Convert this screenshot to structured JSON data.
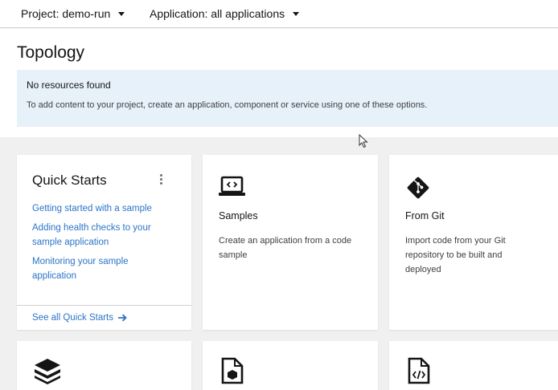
{
  "topbar": {
    "project_label": "Project: demo-run",
    "application_label": "Application: all applications"
  },
  "page": {
    "title": "Topology"
  },
  "alert": {
    "title": "No resources found",
    "body": "To add content to your project, create an application, component or service using one of these options."
  },
  "quick_starts": {
    "title": "Quick Starts",
    "links": [
      "Getting started with a sample",
      "Adding health checks to your sample application",
      "Monitoring your sample application"
    ],
    "see_all": "See all Quick Starts"
  },
  "cards": [
    {
      "icon": "laptop-code-icon",
      "title": "Samples",
      "description": "Create an application from a code sample"
    },
    {
      "icon": "git-icon",
      "title": "From Git",
      "description": "Import code from your Git repository to be built and deployed"
    }
  ],
  "bottom_cards": [
    {
      "icon": "layers-icon"
    },
    {
      "icon": "file-cube-icon"
    },
    {
      "icon": "file-code-icon"
    }
  ],
  "colors": {
    "link": "#2b74c8",
    "alert_bg": "#e7f1fa",
    "page_bg": "#f0f0f0"
  }
}
